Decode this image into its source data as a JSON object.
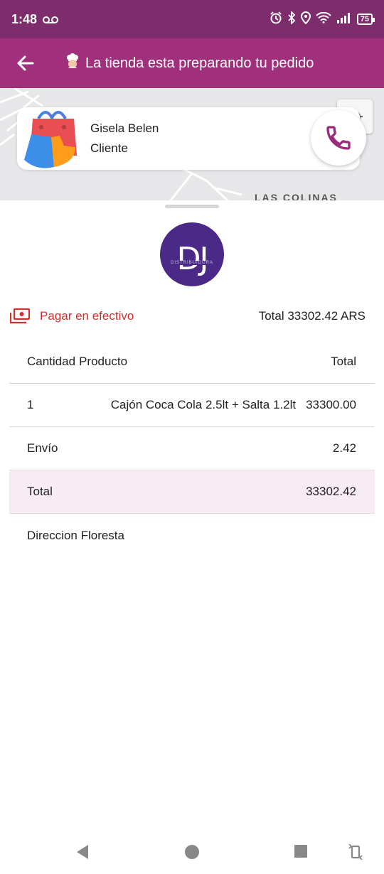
{
  "status_bar": {
    "time": "1:48",
    "battery": "75"
  },
  "app_bar": {
    "title": "La tienda esta preparando tu pedido"
  },
  "map": {
    "area_label": "LAS COLINAS"
  },
  "client": {
    "name": "Gisela Belen",
    "role": "Cliente"
  },
  "store_logo": {
    "letters": "DJ",
    "subtitle": "DISTRIBUIDORA"
  },
  "payment": {
    "method": "Pagar en efectivo",
    "total": "Total 33302.42 ARS"
  },
  "table": {
    "headers": {
      "qty": "Cantidad",
      "product": "Producto",
      "total": "Total"
    },
    "items": [
      {
        "qty": "1",
        "product": "Cajón Coca Cola 2.5lt + Salta 1.2lt",
        "total": "33300.00"
      }
    ],
    "shipping": {
      "label": "Envío",
      "value": "2.42"
    },
    "grand_total": {
      "label": "Total",
      "value": "33302.42"
    },
    "address": "Direccion Floresta"
  },
  "colors": {
    "status_bar": "#7d2c6c",
    "app_bar": "#a0307c",
    "accent_red": "#d32f2f",
    "phone_icon": "#9b2a7c",
    "total_row_bg": "#f7ecf3"
  }
}
